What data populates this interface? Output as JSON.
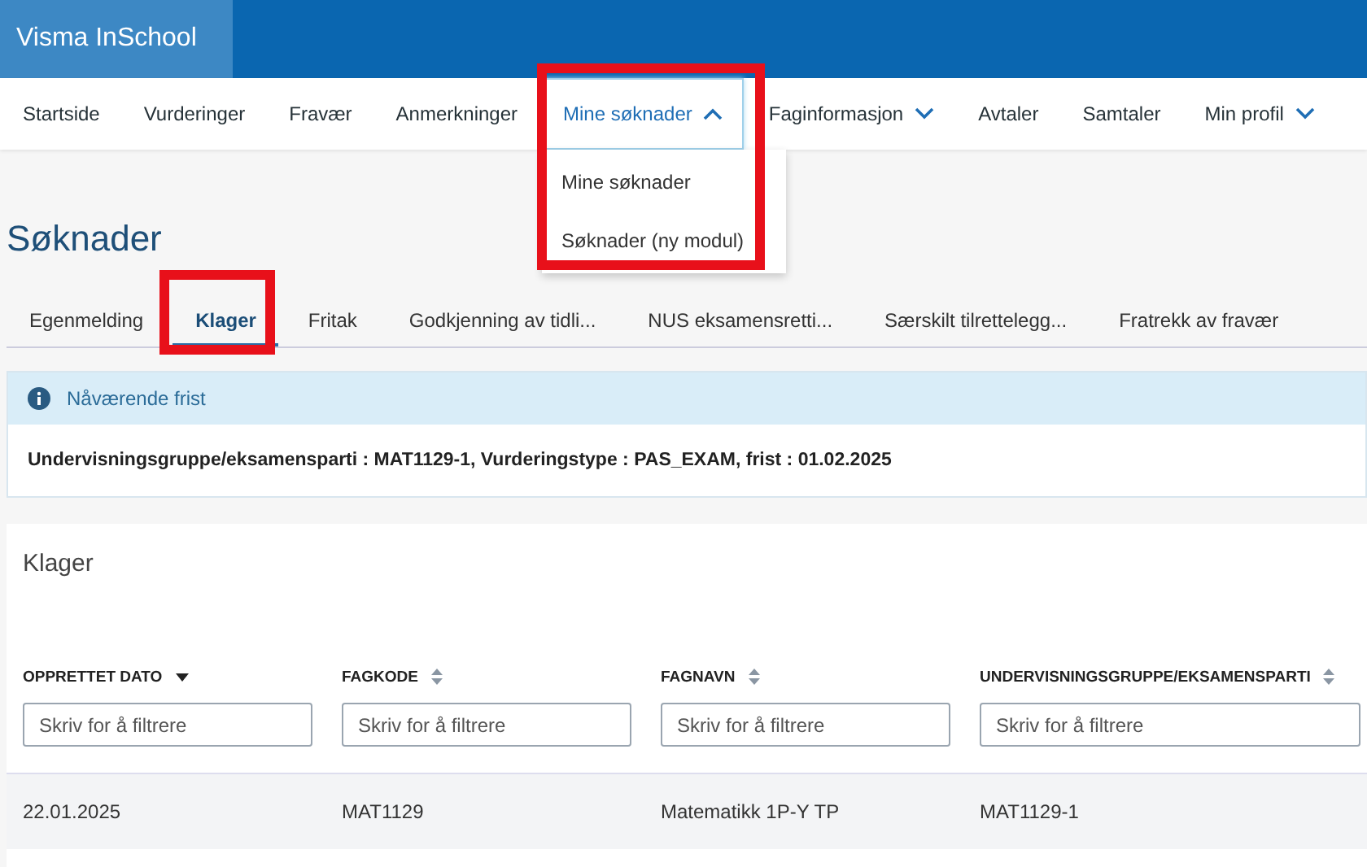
{
  "header": {
    "brand": "Visma InSchool"
  },
  "nav": [
    {
      "label": "Startside",
      "kind": "link",
      "highlighted": false
    },
    {
      "label": "Vurderinger",
      "kind": "link",
      "highlighted": false
    },
    {
      "label": "Fravær",
      "kind": "link",
      "highlighted": false
    },
    {
      "label": "Anmerkninger",
      "kind": "link",
      "highlighted": false
    },
    {
      "label": "Mine søknader",
      "kind": "menu",
      "expanded": true,
      "highlighted": true,
      "menu_items": [
        "Mine søknader",
        "Søknader (ny modul)"
      ]
    },
    {
      "label": "Faginformasjon",
      "kind": "menu",
      "expanded": false,
      "highlighted": false
    },
    {
      "label": "Avtaler",
      "kind": "link",
      "highlighted": false
    },
    {
      "label": "Samtaler",
      "kind": "link",
      "highlighted": false
    },
    {
      "label": "Min profil",
      "kind": "menu",
      "expanded": false,
      "highlighted": false
    }
  ],
  "page_title": "Søknader",
  "tabs": [
    {
      "label": "Egenmelding",
      "selected": false,
      "highlighted": false
    },
    {
      "label": "Klager",
      "selected": true,
      "highlighted": true
    },
    {
      "label": "Fritak",
      "selected": false,
      "highlighted": false
    },
    {
      "label": "Godkjenning av tidli...",
      "selected": false,
      "highlighted": false
    },
    {
      "label": "NUS eksamensretti...",
      "selected": false,
      "highlighted": false
    },
    {
      "label": "Særskilt tilrettelegg...",
      "selected": false,
      "highlighted": false
    },
    {
      "label": "Fratrekk av fravær",
      "selected": false,
      "highlighted": false
    }
  ],
  "info": {
    "title": "Nåværende frist",
    "text": "Undervisningsgruppe/eksamensparti : MAT1129-1, Vurderingstype : PAS_EXAM, frist : 01.02.2025"
  },
  "table": {
    "title": "Klager",
    "columns": [
      {
        "label": "OPPRETTET DATO",
        "sorted": true,
        "filter_placeholder": "Skriv for å filtrere"
      },
      {
        "label": "FAGKODE",
        "sorted": false,
        "filter_placeholder": "Skriv for å filtrere"
      },
      {
        "label": "FAGNAVN",
        "sorted": false,
        "filter_placeholder": "Skriv for å filtrere"
      },
      {
        "label": "UNDERVISNINGSGRUPPE/EKSAMENSPARTI",
        "sorted": false,
        "filter_placeholder": "Skriv for å filtrere"
      }
    ],
    "rows": [
      [
        "22.01.2025",
        "MAT1129",
        "Matematikk 1P-Y TP",
        "MAT1129-1"
      ]
    ]
  }
}
